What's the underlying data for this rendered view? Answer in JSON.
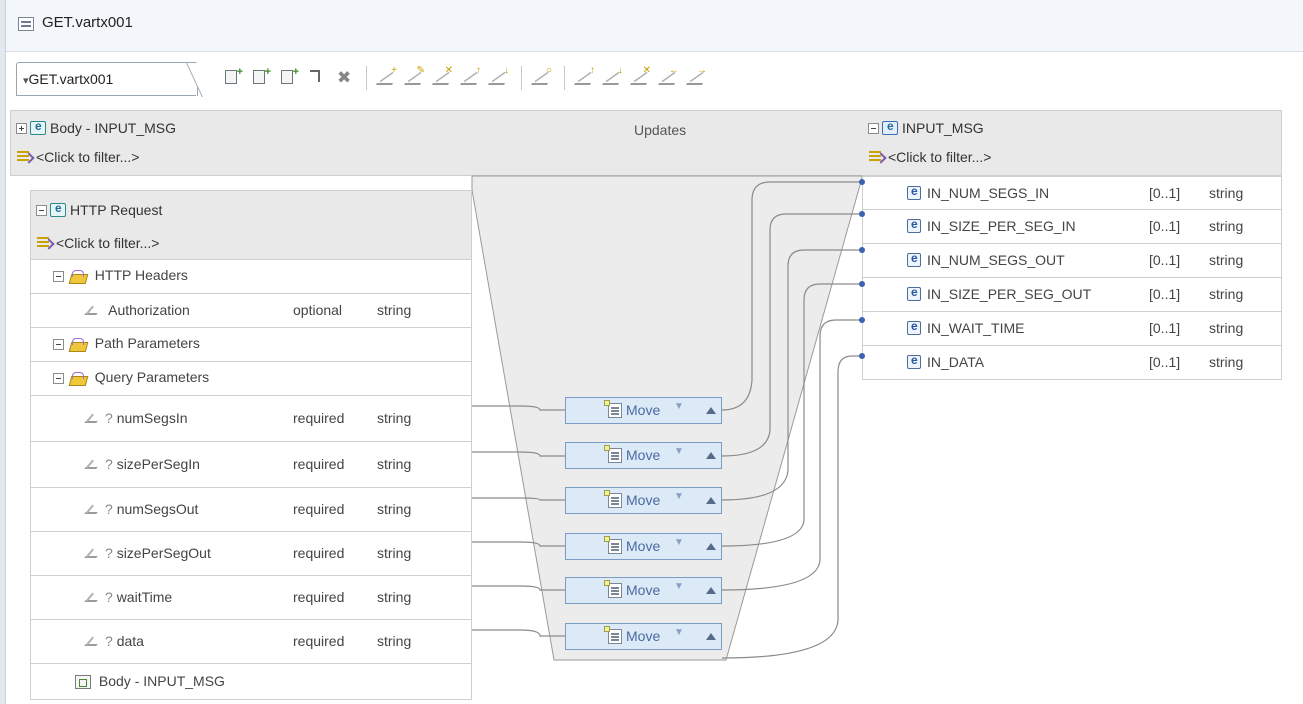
{
  "window": {
    "title": "GET.vartx001"
  },
  "editor_tab": {
    "label": "GET.vartx001"
  },
  "toolbar": {
    "icons": [
      "create-transform-icon",
      "create-transform-icon",
      "create-transform-icon",
      "connect-icon",
      "delete-icon",
      "map-icon",
      "map-icon",
      "map-icon",
      "map-icon",
      "map-icon",
      "map-icon",
      "map-icon",
      "map-icon",
      "map-icon",
      "map-icon",
      "map-icon"
    ]
  },
  "source": {
    "body_header": "Body - INPUT_MSG",
    "body_filter": "<Click to filter...>",
    "http_header": "HTTP Request",
    "http_filter": "<Click to filter...>",
    "rows": {
      "http_headers": "HTTP Headers",
      "authorization": {
        "label": "Authorization",
        "req": "optional",
        "type": "string"
      },
      "path_params": "Path Parameters",
      "query_params": "Query Parameters",
      "params": [
        {
          "label": "numSegsIn",
          "req": "required",
          "type": "string"
        },
        {
          "label": "sizePerSegIn",
          "req": "required",
          "type": "string"
        },
        {
          "label": "numSegsOut",
          "req": "required",
          "type": "string"
        },
        {
          "label": "sizePerSegOut",
          "req": "required",
          "type": "string"
        },
        {
          "label": "waitTime",
          "req": "required",
          "type": "string"
        },
        {
          "label": "data",
          "req": "required",
          "type": "string"
        }
      ],
      "body_footer": "Body - INPUT_MSG"
    }
  },
  "updates": {
    "label": "Updates"
  },
  "transforms": [
    {
      "label": "Move"
    },
    {
      "label": "Move"
    },
    {
      "label": "Move"
    },
    {
      "label": "Move"
    },
    {
      "label": "Move"
    },
    {
      "label": "Move"
    }
  ],
  "target": {
    "header": "INPUT_MSG",
    "filter": "<Click to filter...>",
    "fields": [
      {
        "name": "IN_NUM_SEGS_IN",
        "card": "[0..1]",
        "type": "string"
      },
      {
        "name": "IN_SIZE_PER_SEG_IN",
        "card": "[0..1]",
        "type": "string"
      },
      {
        "name": "IN_NUM_SEGS_OUT",
        "card": "[0..1]",
        "type": "string"
      },
      {
        "name": "IN_SIZE_PER_SEG_OUT",
        "card": "[0..1]",
        "type": "string"
      },
      {
        "name": "IN_WAIT_TIME",
        "card": "[0..1]",
        "type": "string"
      },
      {
        "name": "IN_DATA",
        "card": "[0..1]",
        "type": "string"
      }
    ]
  }
}
